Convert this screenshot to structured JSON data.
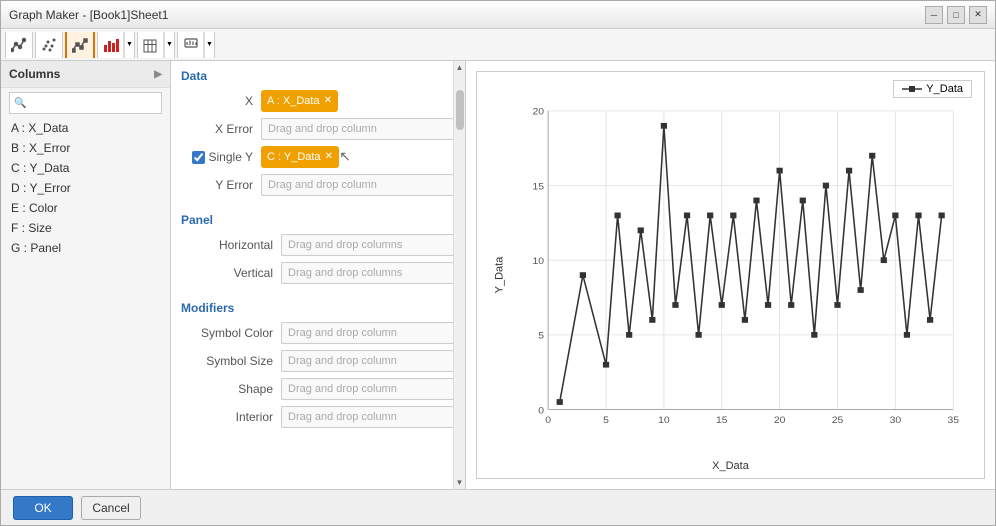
{
  "window": {
    "title": "Graph Maker - [Book1]Sheet1",
    "controls": {
      "minimize": "─",
      "maximize": "□",
      "close": "✕"
    }
  },
  "toolbar": {
    "groups": [
      {
        "buttons": [
          {
            "id": "line1",
            "label": "Line chart 1"
          },
          {
            "id": "line2",
            "label": "Line chart 2"
          },
          {
            "id": "line3",
            "label": "Line chart 3",
            "active": true
          },
          {
            "id": "bar",
            "label": "Bar chart",
            "dropdown": true
          },
          {
            "id": "hist",
            "label": "Histogram",
            "dropdown": true
          },
          {
            "id": "other",
            "label": "Other chart",
            "dropdown": true
          }
        ]
      }
    ]
  },
  "left_panel": {
    "columns_header": "Columns",
    "columns": [
      {
        "key": "A",
        "name": "X_Data"
      },
      {
        "key": "B",
        "name": "X_Error"
      },
      {
        "key": "C",
        "name": "Y_Data"
      },
      {
        "key": "D",
        "name": "Y_Error"
      },
      {
        "key": "E",
        "name": "Color"
      },
      {
        "key": "F",
        "name": "Size"
      },
      {
        "key": "G",
        "name": "Panel"
      }
    ]
  },
  "middle_panel": {
    "data_section": {
      "title": "Data",
      "x_label": "X",
      "x_tag": "A : X_Data",
      "x_error_label": "X Error",
      "x_error_placeholder": "Drag and drop column",
      "single_y_label": "Single Y",
      "y_tag": "C : Y_Data",
      "y_error_label": "Y Error",
      "y_error_placeholder": "Drag and drop column"
    },
    "panel_section": {
      "title": "Panel",
      "horizontal_label": "Horizontal",
      "horizontal_placeholder": "Drag and drop columns",
      "vertical_label": "Vertical",
      "vertical_placeholder": "Drag and drop columns"
    },
    "modifiers_section": {
      "title": "Modifiers",
      "symbol_color_label": "Symbol Color",
      "symbol_color_placeholder": "Drag and drop column",
      "symbol_size_label": "Symbol Size",
      "symbol_size_placeholder": "Drag and drop column",
      "shape_label": "Shape",
      "shape_placeholder": "Drag and drop column",
      "interior_label": "Interior",
      "interior_placeholder": "Drag and drop column"
    }
  },
  "chart": {
    "legend_label": "Y_Data",
    "x_axis_label": "X_Data",
    "y_axis_label": "Y_Data",
    "x_min": 0,
    "x_max": 35,
    "y_min": 0,
    "y_max": 20,
    "data_points": [
      {
        "x": 1,
        "y": 0.5
      },
      {
        "x": 3,
        "y": 9
      },
      {
        "x": 5,
        "y": 3
      },
      {
        "x": 6,
        "y": 13
      },
      {
        "x": 7,
        "y": 5
      },
      {
        "x": 8,
        "y": 12
      },
      {
        "x": 9,
        "y": 6
      },
      {
        "x": 10,
        "y": 19
      },
      {
        "x": 11,
        "y": 7
      },
      {
        "x": 12,
        "y": 13
      },
      {
        "x": 13,
        "y": 5
      },
      {
        "x": 14,
        "y": 13
      },
      {
        "x": 15,
        "y": 7
      },
      {
        "x": 16,
        "y": 13
      },
      {
        "x": 17,
        "y": 6
      },
      {
        "x": 18,
        "y": 14
      },
      {
        "x": 19,
        "y": 7
      },
      {
        "x": 20,
        "y": 16
      },
      {
        "x": 21,
        "y": 7
      },
      {
        "x": 22,
        "y": 14
      },
      {
        "x": 23,
        "y": 5
      },
      {
        "x": 24,
        "y": 15
      },
      {
        "x": 25,
        "y": 7
      },
      {
        "x": 26,
        "y": 16
      },
      {
        "x": 27,
        "y": 8
      },
      {
        "x": 28,
        "y": 17
      },
      {
        "x": 29,
        "y": 10
      },
      {
        "x": 30,
        "y": 13
      },
      {
        "x": 31,
        "y": 5
      },
      {
        "x": 32,
        "y": 13
      },
      {
        "x": 33,
        "y": 6
      },
      {
        "x": 34,
        "y": 13
      }
    ],
    "x_ticks": [
      0,
      5,
      10,
      15,
      20,
      25,
      30,
      35
    ],
    "y_ticks": [
      0,
      5,
      10,
      15,
      20
    ]
  },
  "bottom": {
    "ok_label": "OK",
    "cancel_label": "Cancel"
  }
}
